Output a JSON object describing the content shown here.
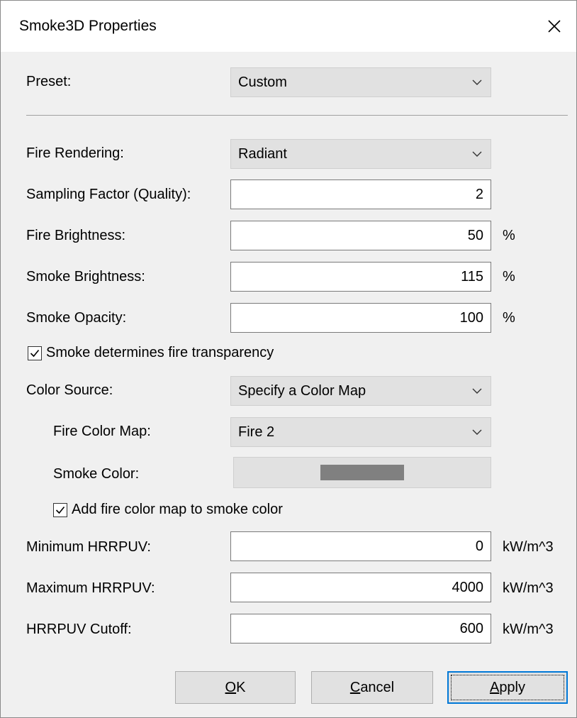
{
  "window": {
    "title": "Smoke3D Properties"
  },
  "preset": {
    "label": "Preset:",
    "value": "Custom"
  },
  "fire_rendering": {
    "label": "Fire Rendering:",
    "value": "Radiant"
  },
  "sampling_factor": {
    "label": "Sampling Factor (Quality):",
    "value": "2"
  },
  "fire_brightness": {
    "label": "Fire Brightness:",
    "value": "50",
    "unit": "%"
  },
  "smoke_brightness": {
    "label": "Smoke Brightness:",
    "value": "115",
    "unit": "%"
  },
  "smoke_opacity": {
    "label": "Smoke Opacity:",
    "value": "100",
    "unit": "%"
  },
  "smoke_transparency": {
    "label": "Smoke determines fire transparency",
    "checked": true
  },
  "color_source": {
    "label": "Color Source:",
    "value": "Specify a Color Map"
  },
  "fire_color_map": {
    "label": "Fire Color Map:",
    "value": "Fire 2"
  },
  "smoke_color": {
    "label": "Smoke Color:",
    "swatch_color": "#808080"
  },
  "add_fire_color": {
    "label": "Add fire color map to smoke color",
    "checked": true
  },
  "min_hrrpuv": {
    "label": "Minimum HRRPUV:",
    "value": "0",
    "unit": "kW/m^3"
  },
  "max_hrrpuv": {
    "label": "Maximum HRRPUV:",
    "value": "4000",
    "unit": "kW/m^3"
  },
  "hrrpuv_cutoff": {
    "label": "HRRPUV Cutoff:",
    "value": "600",
    "unit": "kW/m^3"
  },
  "buttons": {
    "ok": {
      "label": "OK",
      "mnemonic": "O",
      "rest": "K"
    },
    "cancel": {
      "label": "Cancel",
      "mnemonic": "C",
      "rest": "ancel"
    },
    "apply": {
      "label": "Apply",
      "mnemonic": "A",
      "rest": "pply"
    }
  },
  "colors": {
    "accent": "#0078d7",
    "dialog_bg": "#f0f0f0",
    "button_bg": "#e1e1e1"
  },
  "icons": {
    "close": "close-icon",
    "dropdown": "chevron-down-icon",
    "check": "checkmark-icon"
  }
}
